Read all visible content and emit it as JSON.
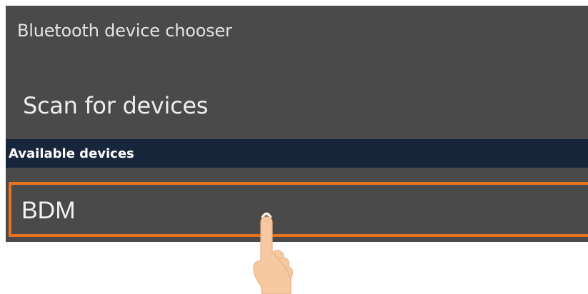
{
  "dialog": {
    "title": "Bluetooth device chooser",
    "scan_label": "Scan for devices",
    "section_header": "Available devices",
    "devices": [
      {
        "label": "BDM",
        "highlighted": true
      }
    ]
  },
  "overlay": {
    "icon": "tapping-hand-icon",
    "highlight_color": "#e8731f"
  }
}
